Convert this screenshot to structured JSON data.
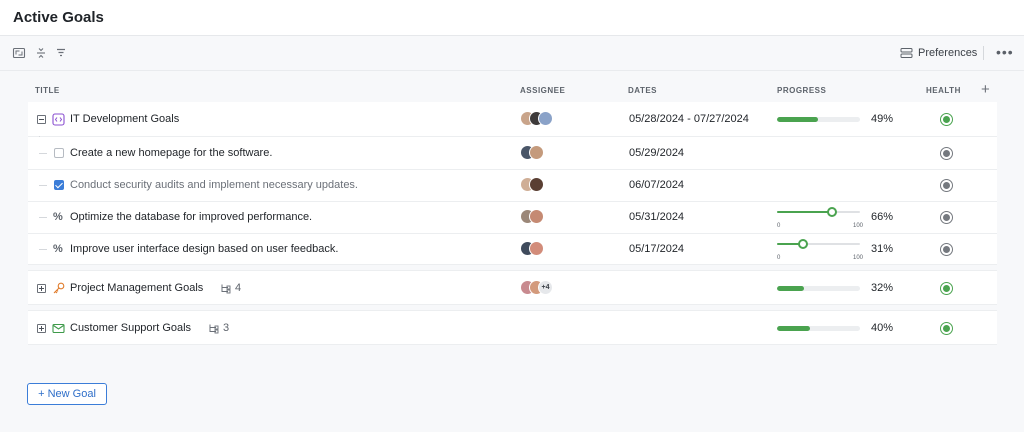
{
  "page": {
    "title": "Active Goals"
  },
  "toolbar": {
    "icons": [
      "expand-icon",
      "collapse-all-icon",
      "filter-icon"
    ],
    "preferences_label": "Preferences",
    "more_label": "•••"
  },
  "columns": {
    "title": "TITLE",
    "assignee": "ASSIGNEE",
    "dates": "DATES",
    "progress": "PROGRESS",
    "health": "HEALTH",
    "add": "+"
  },
  "colors": {
    "green": "#4aa34f",
    "gray": "#75797f",
    "accent": "#3b7dd8"
  },
  "goals": [
    {
      "title": "IT Development Goals",
      "icon": "code-file-icon",
      "expanded": true,
      "dates": "05/28/2024 - 07/27/2024",
      "progress": 49,
      "progress_label": "49%",
      "health": "green",
      "tasks": [
        {
          "title": "Create a new homepage for the software.",
          "type": "checkbox",
          "checked": false,
          "dates": "05/29/2024",
          "health": "gray"
        },
        {
          "title": "Conduct security audits and implement necessary updates.",
          "type": "checkbox",
          "checked": true,
          "dates": "06/07/2024",
          "health": "gray"
        },
        {
          "title": "Optimize the database for improved performance.",
          "type": "percent",
          "dates": "05/31/2024",
          "progress": 66,
          "progress_label": "66%",
          "slider_min": "0",
          "slider_max": "100",
          "health": "gray"
        },
        {
          "title": "Improve user interface design based on user feedback.",
          "type": "percent",
          "dates": "05/17/2024",
          "progress": 31,
          "progress_label": "31%",
          "slider_min": "0",
          "slider_max": "100",
          "health": "gray"
        }
      ]
    },
    {
      "title": "Project Management Goals",
      "icon": "key-icon",
      "expanded": false,
      "subgoal_count": "4",
      "assignee_more": "+4",
      "progress": 32,
      "progress_label": "32%",
      "health": "green"
    },
    {
      "title": "Customer Support Goals",
      "icon": "mail-icon",
      "expanded": false,
      "subgoal_count": "3",
      "progress": 40,
      "progress_label": "40%",
      "health": "green"
    }
  ],
  "new_goal_label": "+ New Goal"
}
